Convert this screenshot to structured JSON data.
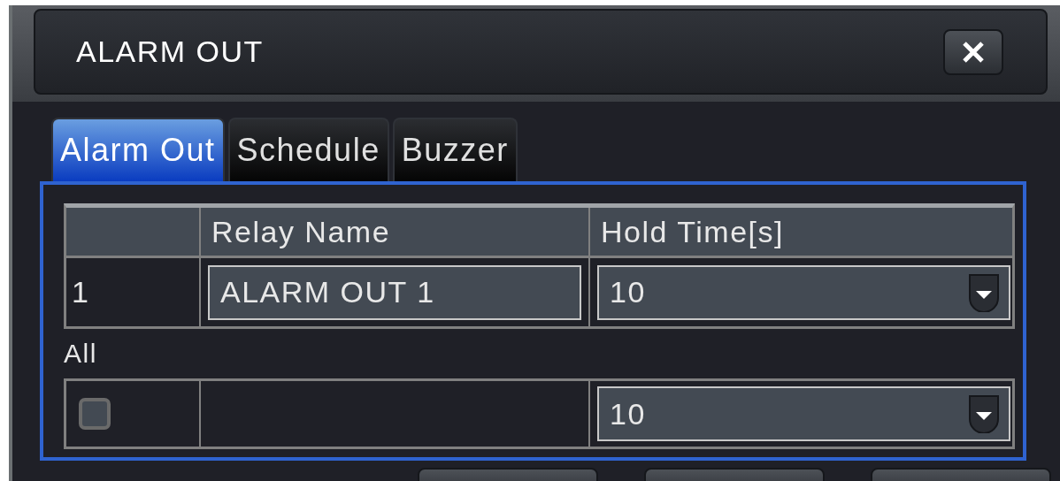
{
  "window": {
    "title": "ALARM OUT"
  },
  "tabs": [
    {
      "label": "Alarm Out",
      "selected": true
    },
    {
      "label": "Schedule",
      "selected": false
    },
    {
      "label": "Buzzer",
      "selected": false
    }
  ],
  "table": {
    "columns": [
      "Relay Name",
      "Hold Time[s]"
    ],
    "rows": [
      {
        "index": "1",
        "relay_name": "ALARM OUT 1",
        "hold_time": "10"
      }
    ]
  },
  "all": {
    "label": "All",
    "checked": false,
    "hold_time": "10"
  }
}
